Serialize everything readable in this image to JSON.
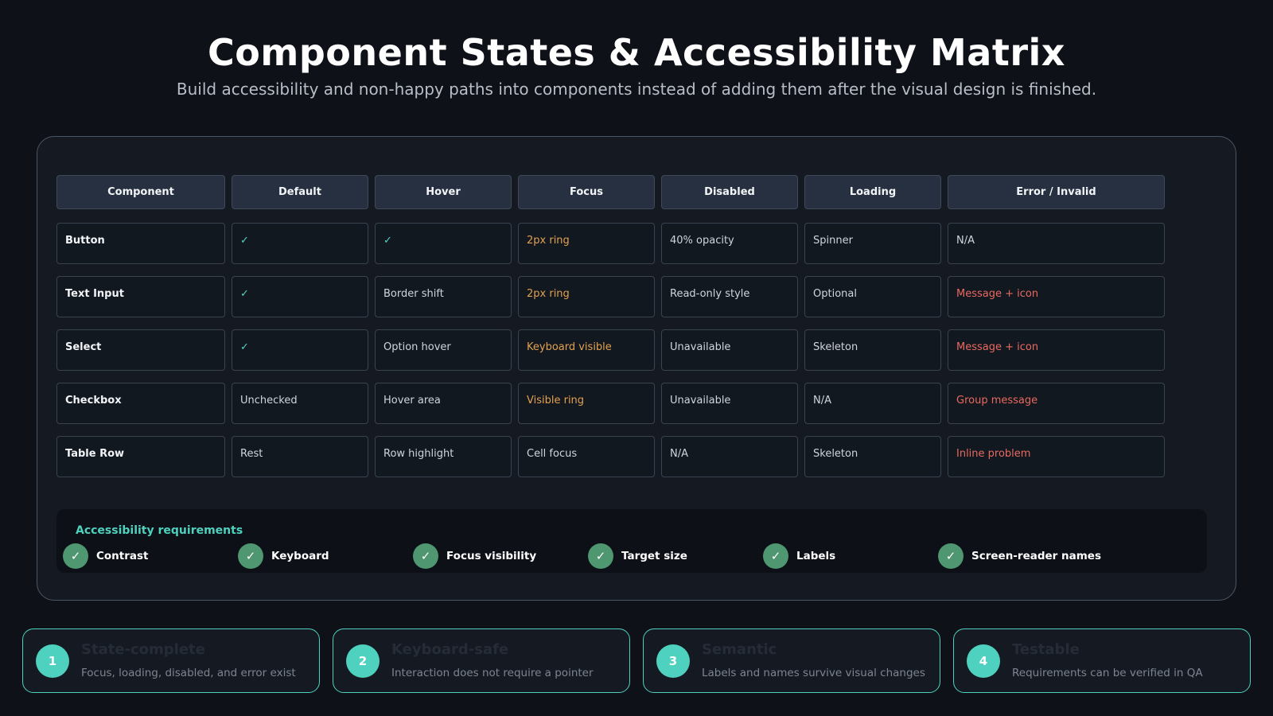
{
  "header": {
    "title": "Component States & Accessibility Matrix",
    "subtitle": "Build accessibility and non-happy paths into components instead of adding them after the visual design is finished."
  },
  "matrix": {
    "columns": [
      "Component",
      "Default",
      "Hover",
      "Focus",
      "Disabled",
      "Loading",
      "Error / Invalid"
    ],
    "rows": [
      {
        "component": "Button",
        "default": "✓",
        "hover": "✓",
        "focus": "2px ring",
        "disabled": "40% opacity",
        "loading": "Spinner",
        "error": "N/A"
      },
      {
        "component": "Text Input",
        "default": "✓",
        "hover": "Border shift",
        "focus": "2px ring",
        "disabled": "Read-only style",
        "loading": "Optional",
        "error": "Message + icon"
      },
      {
        "component": "Select",
        "default": "✓",
        "hover": "Option hover",
        "focus": "Keyboard visible",
        "disabled": "Unavailable",
        "loading": "Skeleton",
        "error": "Message + icon"
      },
      {
        "component": "Checkbox",
        "default": "Unchecked",
        "hover": "Hover area",
        "focus": "Visible ring",
        "disabled": "Unavailable",
        "loading": "N/A",
        "error": "Group message"
      },
      {
        "component": "Table Row",
        "default": "Rest",
        "hover": "Row highlight",
        "focus": "Cell focus",
        "disabled": "N/A",
        "loading": "Skeleton",
        "error": "Inline problem"
      }
    ]
  },
  "requirements": {
    "title": "Accessibility requirements",
    "check_icon": "check-icon",
    "items": [
      "Contrast",
      "Keyboard",
      "Focus visibility",
      "Target size",
      "Labels",
      "Screen-reader names"
    ]
  },
  "principles": [
    {
      "number": "1",
      "title": "State-complete",
      "description": "Focus, loading, disabled, and error exist"
    },
    {
      "number": "2",
      "title": "Keyboard-safe",
      "description": "Interaction does not require a pointer"
    },
    {
      "number": "3",
      "title": "Semantic",
      "description": "Labels and names survive visual changes"
    },
    {
      "number": "4",
      "title": "Testable",
      "description": "Requirements can be verified in QA"
    }
  ],
  "colors": {
    "background": "#0e1117",
    "accent_teal": "#4fd1bf",
    "focus_orange": "#e3a14f",
    "error_red": "#e9695f",
    "check_green": "#4f9770"
  }
}
